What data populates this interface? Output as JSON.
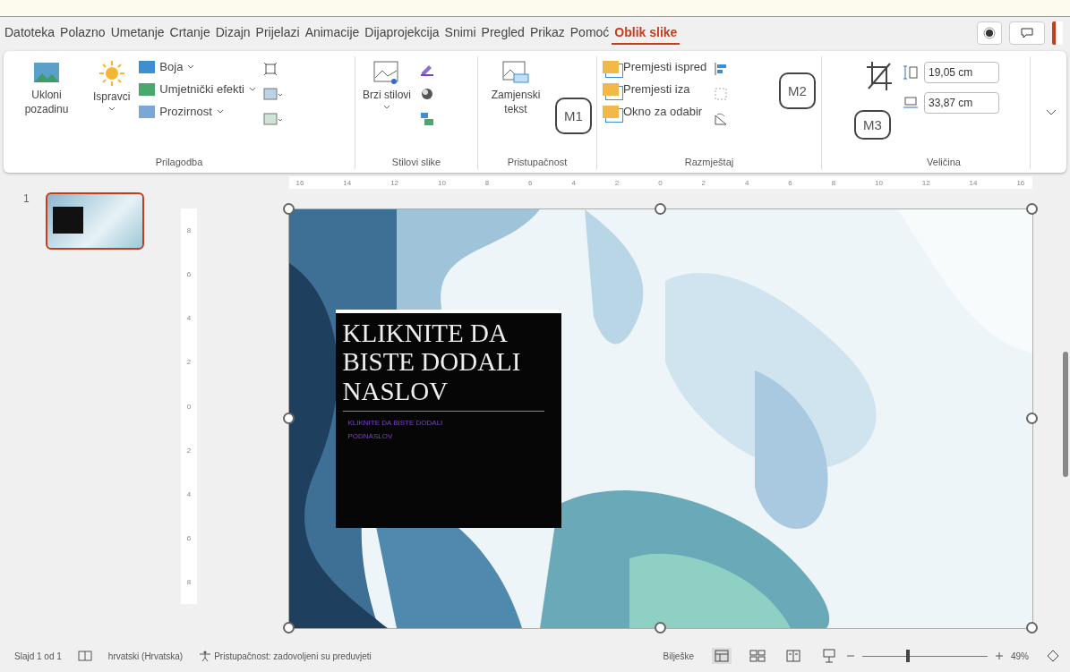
{
  "tabs": [
    {
      "label": "Datoteka",
      "selected": false
    },
    {
      "label": "Polazno",
      "selected": false
    },
    {
      "label": "Umetanje",
      "selected": false
    },
    {
      "label": "Crtanje",
      "selected": false
    },
    {
      "label": "Dizajn",
      "selected": false
    },
    {
      "label": "Prijelazi",
      "selected": false
    },
    {
      "label": "Animacije",
      "selected": false
    },
    {
      "label": "Dijaprojekcija",
      "selected": false
    },
    {
      "label": "Snimi",
      "selected": false
    },
    {
      "label": "Pregled",
      "selected": false
    },
    {
      "label": "Prikaz",
      "selected": false
    },
    {
      "label": "Pomoć",
      "selected": false
    },
    {
      "label": "Oblik slike",
      "selected": true
    }
  ],
  "ribbon": {
    "adjust": {
      "label": "Prilagodba",
      "remove_bg": "Ukloni pozadinu",
      "corrections": "Ispravci",
      "items": [
        "Boja",
        "Umjetnički efekti",
        "Prozirnost"
      ]
    },
    "styles": {
      "label": "Stilovi slike",
      "quick": "Brzi stilovi"
    },
    "access": {
      "label": "Pristupačnost",
      "alt_text": "Zamjenski tekst"
    },
    "arrange": {
      "label": "Razmještaj",
      "items": [
        "Premjesti ispred",
        "Premjesti iza",
        "Okno za odabir"
      ]
    },
    "size": {
      "label": "Veličina",
      "height": "19,05 cm",
      "width": "33,87 cm"
    }
  },
  "callouts": [
    "M1",
    "M2",
    "M3"
  ],
  "slides": [
    {
      "number": "1",
      "selected": true
    }
  ],
  "ruler": {
    "horizontal": [
      "16",
      "14",
      "12",
      "10",
      "8",
      "6",
      "4",
      "2",
      "0",
      "2",
      "4",
      "6",
      "8",
      "10",
      "12",
      "14",
      "16"
    ],
    "vertical": [
      "8",
      "6",
      "4",
      "2",
      "0",
      "2",
      "4",
      "6",
      "8"
    ]
  },
  "slide": {
    "title": "KLIKNITE DA BISTE DODALI NASLOV",
    "subtitle": "KLIKNITE DA BISTE DODALI PODNASLOV"
  },
  "status_bar": {
    "slide": "Slajd 1 od 1",
    "language": "hrvatski (Hrvatska)",
    "accessibility": "Pristupačnost: zadovoljeni su preduvjeti",
    "notes": "Bilješke",
    "zoom": "49%",
    "level": 0.35
  }
}
